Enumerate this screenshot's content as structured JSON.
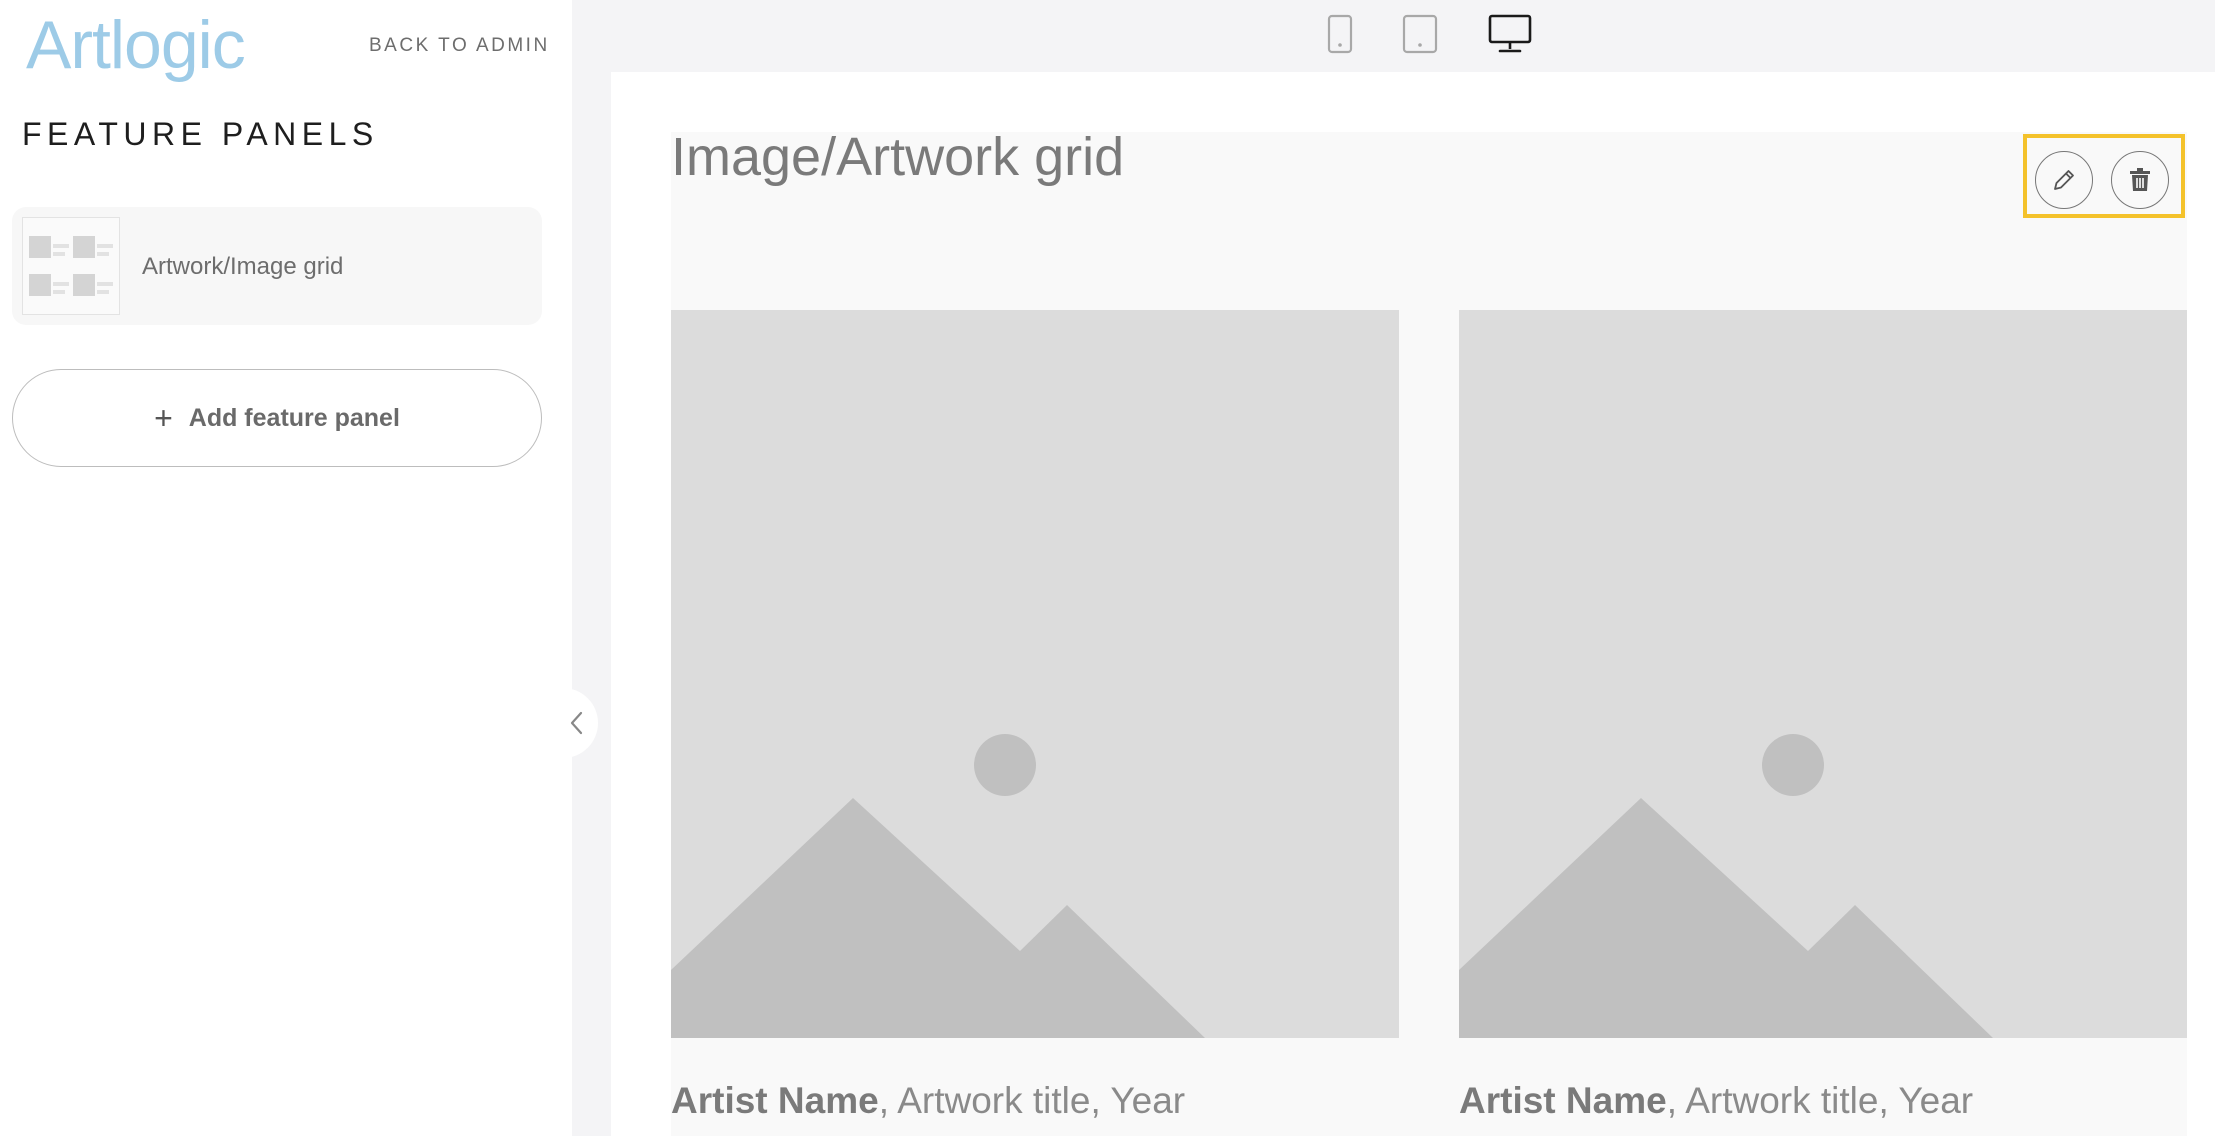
{
  "sidebar": {
    "logo": "Artlogic",
    "back_link": "BACK TO ADMIN",
    "title": "FEATURE PANELS",
    "panels": [
      {
        "label": "Artwork/Image grid"
      }
    ],
    "add_button": {
      "icon": "+",
      "label": "Add feature panel"
    }
  },
  "toolbar": {
    "devices": [
      {
        "name": "mobile",
        "icon": "phone-icon",
        "active": false
      },
      {
        "name": "tablet",
        "icon": "tablet-icon",
        "active": false
      },
      {
        "name": "desktop",
        "icon": "desktop-icon",
        "active": true
      }
    ]
  },
  "preview": {
    "panel_title": "Image/Artwork grid",
    "actions": {
      "edit_icon": "pencil-icon",
      "delete_icon": "trash-icon",
      "highlight_color": "#f4c22b"
    },
    "items": [
      {
        "artist": "Artist Name",
        "details": ", Artwork title, Year"
      },
      {
        "artist": "Artist Name",
        "details": ", Artwork title, Year"
      }
    ]
  },
  "colors": {
    "logo": "#9dcbe7",
    "placeholder_bg": "#dcdcdc",
    "placeholder_shape": "#c0c0c0"
  }
}
